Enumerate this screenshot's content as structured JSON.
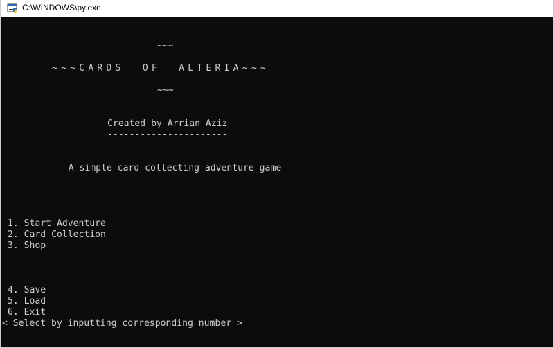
{
  "window": {
    "title": "C:\\WINDOWS\\py.exe",
    "icon": "python-console-icon"
  },
  "console": {
    "banner_top": "~~~",
    "banner_title": "~~~CARDS  OF  ALTERIA~~~",
    "banner_bottom": "~~~",
    "credit": "Created by Arrian Aziz",
    "credit_underline": "----------------------",
    "tagline": "- A simple card-collecting adventure game -",
    "menu_items": [
      "1. Start Adventure",
      "2. Card Collection",
      "3. Shop",
      "4. Save",
      "5. Load",
      "6. Exit"
    ],
    "prompt": "< Select by inputting corresponding number >",
    "colors": {
      "background": "#0c0c0c",
      "text": "#cccccc"
    }
  }
}
